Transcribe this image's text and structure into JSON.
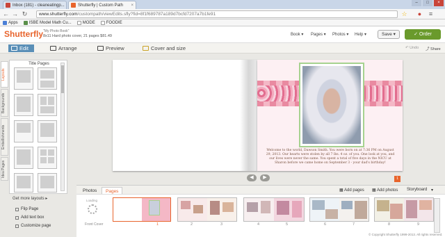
{
  "browser": {
    "tabs": [
      {
        "title": "Inbox (181) - cleaneatingp...",
        "icon": "gmail-icon",
        "color": "#c9453a"
      },
      {
        "title": "Shutterfly | Custom Path",
        "icon": "shutterfly-icon",
        "color": "#e8642c"
      }
    ],
    "url_domain": "www.shutterfly.com",
    "url_path": "/custompath/viewEdits.sfly?fid=8f1f689787a189d7bcfd7207a7b1fe91",
    "bookmarks": [
      {
        "label": "Apps",
        "color": "#4a7fd6"
      },
      {
        "label": "ISBE Model Math Cu...",
        "color": "#5a8f4a"
      },
      {
        "label": "MODE",
        "color": "#999999"
      },
      {
        "label": "FOODIE",
        "color": "#999999"
      }
    ]
  },
  "header": {
    "logo": "Shutterfly",
    "project_title": "\"My Photo Book\"",
    "project_info": "8x11 Hard photo cover, 21 pages $81.49",
    "menus": [
      "Book",
      "Pages",
      "Photos",
      "Help"
    ],
    "save": "Save",
    "order": "Order"
  },
  "toolbar": {
    "tabs": [
      "Edit",
      "Arrange",
      "Preview",
      "Cover and size"
    ],
    "undo": "Undo",
    "share": "Share"
  },
  "sidebar": {
    "side_tabs": [
      "Layouts",
      "Backgrounds",
      "Embellishments",
      "Idea Pages"
    ],
    "panel_title": "Title Pages",
    "get_more": "Get more layouts",
    "actions": [
      "Flip Page",
      "Add text box",
      "Customize page"
    ]
  },
  "book": {
    "caption": "Welcome to the world, Dawson Smith. You were born on at 7:36 PM on August 29, 2013. Our hearts were stolen by all 7 lbs. 4 oz. of you. One look at you, and our lives were never the same. You spent a total of five days in the NICU at Sharon before we came home on September 3 - your dad's birthday!",
    "badge": "1"
  },
  "filmstrip": {
    "tabs": [
      "Photos",
      "Pages"
    ],
    "actions": [
      "Add pages",
      "Add photos",
      "Storyboard"
    ],
    "front_cover": "Front Cover",
    "loading": "Loading",
    "page_numbers": [
      "1",
      "2",
      "3",
      "4",
      "5",
      "6",
      "7",
      "8",
      "9"
    ],
    "copyright": "© Copyright Shutterfly 1999-2013. All rights reserved."
  },
  "colors": {
    "brand_orange": "#e8642c",
    "order_green": "#6a9a2c",
    "active_tab_blue": "#5a8fb7",
    "page_pink": "#e98aa1",
    "photo_frame_green": "#a6d28f"
  }
}
